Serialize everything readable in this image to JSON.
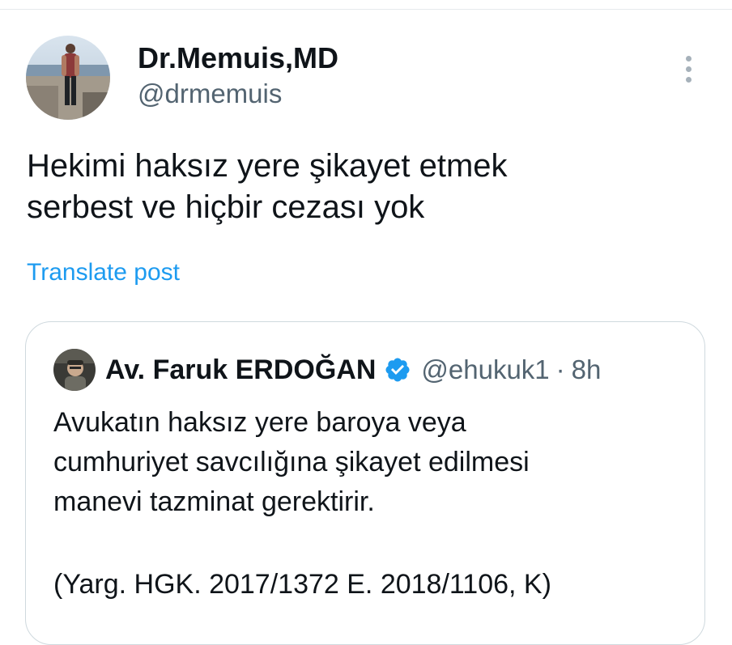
{
  "post": {
    "author": {
      "display_name": "Dr.Memuis,MD",
      "handle": "@drmemuis",
      "avatar_icon": "profile-photo-icon"
    },
    "text_lines": [
      "Hekimi haksız yere şikayet etmek",
      "serbest ve hiçbir cezası yok"
    ],
    "translate_label": "Translate post",
    "more_icon": "more-options-icon"
  },
  "quote": {
    "author": {
      "display_name": "Av. Faruk ERDOĞAN",
      "handle": "@ehukuk1",
      "separator": "·",
      "time": "8h",
      "verified_icon": "verified-badge-icon",
      "avatar_icon": "profile-photo-icon"
    },
    "text_lines": [
      "Avukatın haksız yere baroya veya",
      "cumhuriyet savcılığına şikayet edilmesi",
      "manevi tazminat gerektirir."
    ],
    "citation": "(Yarg. HGK. 2017/1372 E. 2018/1106, K)"
  },
  "colors": {
    "text_primary": "#0f1419",
    "text_secondary": "#536471",
    "link": "#1d9bf0",
    "border": "#cfd9de",
    "verified": "#1d9bf0"
  }
}
